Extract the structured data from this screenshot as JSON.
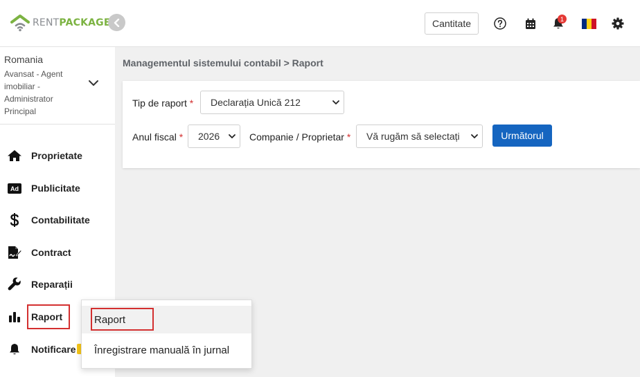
{
  "brand": {
    "part1": "RENT",
    "part2": "PACKAGE",
    "accent": "#7cb342"
  },
  "header": {
    "quantity_button": "Cantitate",
    "notification_count": "1",
    "icons": [
      "help-icon",
      "calendar-icon",
      "bell-icon",
      "romania-flag-icon",
      "gear-icon"
    ]
  },
  "user": {
    "country": "Romania",
    "role": "Avansat - Agent imobiliar - Administrator Principal"
  },
  "sidebar": {
    "items": [
      {
        "label": "Proprietate",
        "icon": "home-icon"
      },
      {
        "label": "Publicitate",
        "icon": "ad-icon"
      },
      {
        "label": "Contabilitate",
        "icon": "dollar-icon"
      },
      {
        "label": "Contract",
        "icon": "contract-icon"
      },
      {
        "label": "Reparații",
        "icon": "wrench-icon"
      },
      {
        "label": "Raport",
        "icon": "bar-chart-icon"
      },
      {
        "label": "Notificare",
        "icon": "bell-icon"
      }
    ]
  },
  "breadcrumb": "Managementul sistemului contabil > Raport",
  "form": {
    "report_type_label": "Tip de raport",
    "report_type_value": "Declarația Unică 212",
    "fiscal_year_label": "Anul fiscal",
    "fiscal_year_value": "2026",
    "company_label": "Companie / Proprietar",
    "company_value": "Vă rugăm să selectați",
    "required_mark": "*",
    "next_button": "Următorul"
  },
  "dropdown": {
    "items": [
      "Raport",
      "Înregistrare manuală în jurnal"
    ]
  }
}
